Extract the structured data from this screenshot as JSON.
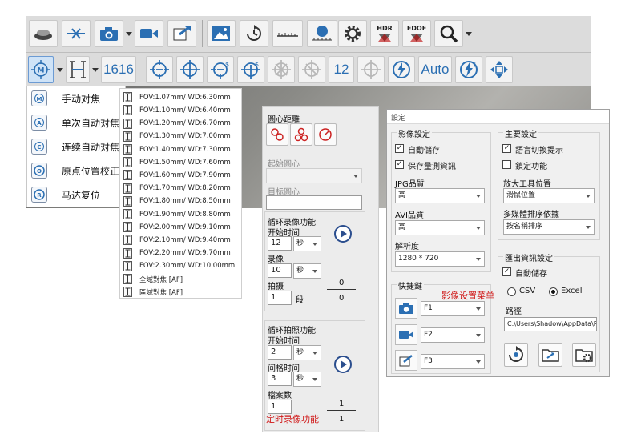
{
  "toolbar1": {
    "buttons": [
      "overview-icon",
      "scale-icon",
      "camera-icon",
      "video-icon",
      "export-icon",
      "image-icon",
      "refresh-icon",
      "ruler-icon",
      "point-measure-icon",
      "gear-icon"
    ],
    "hdr_label": "HDR",
    "edof_label": "EDOF"
  },
  "toolbar2": {
    "focus_value": "1616",
    "step_value": "12",
    "auto_label": "Auto"
  },
  "focus_menu": {
    "items": [
      "手动对焦",
      "单次自动对焦",
      "连续自动对焦",
      "原点位置校正",
      "马达复位"
    ]
  },
  "fov_list": {
    "items": [
      "FOV:1.07mm/ WD:6.30mm",
      "FOV:1.10mm/ WD:6.40mm",
      "FOV:1.20mm/ WD:6.70mm",
      "FOV:1.30mm/ WD:7.00mm",
      "FOV:1.40mm/ WD:7.30mm",
      "FOV:1.50mm/ WD:7.60mm",
      "FOV:1.60mm/ WD:7.90mm",
      "FOV:1.70mm/ WD:8.20mm",
      "FOV:1.80mm/ WD:8.50mm",
      "FOV:1.90mm/ WD:8.80mm",
      "FOV:2.00mm/ WD:9.10mm",
      "FOV:2.10mm/ WD:9.40mm",
      "FOV:2.20mm/ WD:9.70mm",
      "FOV:2.30mm/ WD:10.00mm",
      "全域對焦 [AF]",
      "區域對焦 [AF]"
    ]
  },
  "circle_panel": {
    "title": "圓心距離",
    "start_label": "起始圓心",
    "target_label": "目标圓心"
  },
  "loop_record": {
    "title": "循环录像功能",
    "start_time_label": "开始时间",
    "start_value": "12",
    "start_unit": "秒",
    "record_label": "录像",
    "record_value": "10",
    "record_unit": "秒",
    "shots_label": "拍摄",
    "shots_value": "1",
    "shots_unit": "段",
    "count_top": "0",
    "count_bottom": "0"
  },
  "loop_photo": {
    "title": "循环拍照功能",
    "start_time_label": "开始时间",
    "start_value": "2",
    "start_unit": "秒",
    "interval_label": "间格时间",
    "interval_value": "3",
    "interval_unit": "秒",
    "files_label": "檔案数",
    "files_value": "1",
    "count_top": "1",
    "count_bottom": "1",
    "note": "定时录像功能"
  },
  "settings": {
    "title": "設定",
    "image_section": "影像設定",
    "auto_save": "自動儲存",
    "save_measure": "保存量測資訊",
    "jpg_quality_label": "JPG品質",
    "jpg_quality": "高",
    "avi_quality_label": "AVI品質",
    "avi_quality": "高",
    "resolution_label": "解析度",
    "resolution": "1280 * 720",
    "hotkey_label": "快捷鍵",
    "hotkey_note": "影像设置菜单",
    "hotkeys": [
      "F1",
      "F2",
      "F3"
    ],
    "main_section": "主要設定",
    "switch_hint": "語言切換提示",
    "lock_func": "鎖定功能",
    "zoom_pos_label": "放大工具位置",
    "zoom_pos": "滑鼠位置",
    "sort_label": "多媒體排序依據",
    "sort": "按名稱排序",
    "export_section": "匯出資訊設定",
    "export_auto": "自動儲存",
    "csv_label": "CSV",
    "excel_label": "Excel",
    "path_label": "路徑",
    "path": "C:\\Users\\Shadow\\AppData\\Ro"
  },
  "colors": {
    "accent": "#2b6fb3",
    "toolbar_bg": "#dcdcdc",
    "note_red": "#d01818"
  }
}
